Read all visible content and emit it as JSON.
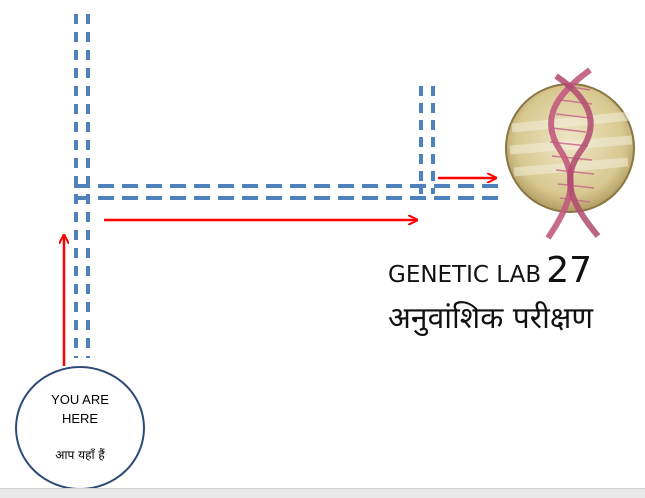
{
  "lab": {
    "title_text": "GENETIC LAB",
    "title_number": "27",
    "title_hindi": "अनुवांशिक परीक्षण"
  },
  "marker": {
    "line1": "YOU ARE",
    "line2": "HERE",
    "hindi": "आप यहाँ हैं"
  },
  "colors": {
    "path": "#4f81bd",
    "arrow": "#ff0000",
    "circle_border": "#2f4a76"
  },
  "icons": {
    "dna": "dna-icon"
  }
}
